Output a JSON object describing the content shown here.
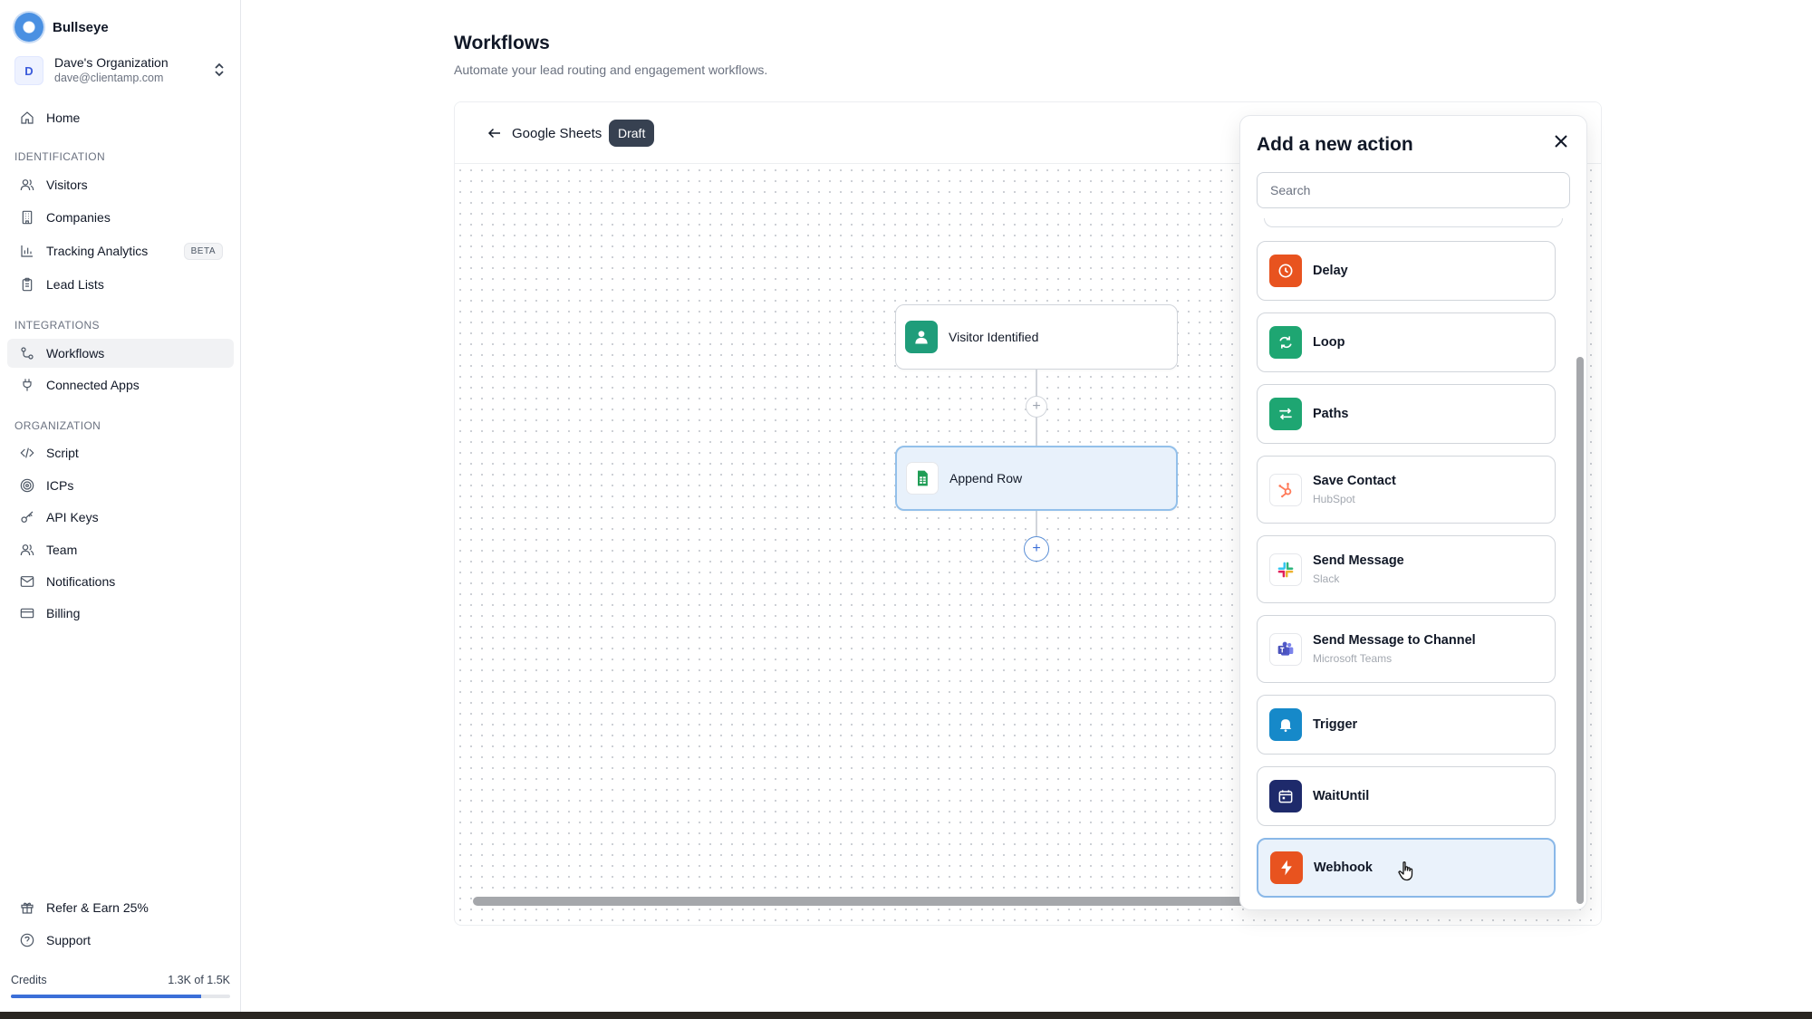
{
  "app": {
    "brand_name": "Bullseye",
    "org_name": "Dave's Organization",
    "org_email": "dave@clientamp.com",
    "org_initial": "D"
  },
  "sidebar": {
    "home": "Home",
    "section_identification": "IDENTIFICATION",
    "visitors": "Visitors",
    "companies": "Companies",
    "tracking_analytics": "Tracking Analytics",
    "beta_badge": "BETA",
    "lead_lists": "Lead Lists",
    "section_integrations": "INTEGRATIONS",
    "workflows": "Workflows",
    "connected_apps": "Connected Apps",
    "section_organization": "ORGANIZATION",
    "script": "Script",
    "icps": "ICPs",
    "api_keys": "API Keys",
    "team": "Team",
    "notifications": "Notifications",
    "billing": "Billing",
    "refer": "Refer & Earn 25%",
    "support": "Support",
    "credits_label": "Credits",
    "credits_value": "1.3K of 1.5K",
    "credits_fraction": 0.867
  },
  "main": {
    "title": "Workflows",
    "subtitle": "Automate your lead routing and engagement workflows.",
    "workflow_name": "Google Sheets",
    "status_badge": "Draft",
    "nodes": {
      "trigger_label": "Visitor Identified",
      "action_label": "Append Row"
    }
  },
  "panel": {
    "title": "Add a new action",
    "search_placeholder": "Search",
    "actions": [
      {
        "label": "Delay",
        "sub": "",
        "icon": "clock-icon",
        "color": "#e8531f"
      },
      {
        "label": "Loop",
        "sub": "",
        "icon": "loop-icon",
        "color": "#1ea672"
      },
      {
        "label": "Paths",
        "sub": "",
        "icon": "paths-icon",
        "color": "#1ea672"
      },
      {
        "label": "Save Contact",
        "sub": "HubSpot",
        "icon": "hubspot-icon",
        "color": "#ff7a59"
      },
      {
        "label": "Send Message",
        "sub": "Slack",
        "icon": "slack-icon",
        "color": "#4a154b"
      },
      {
        "label": "Send Message to Channel",
        "sub": "Microsoft Teams",
        "icon": "teams-icon",
        "color": "#5059c9"
      },
      {
        "label": "Trigger",
        "sub": "",
        "icon": "bell-icon",
        "color": "#1689c9"
      },
      {
        "label": "WaitUntil",
        "sub": "",
        "icon": "calendar-icon",
        "color": "#1e2a6b"
      },
      {
        "label": "Webhook",
        "sub": "",
        "icon": "bolt-icon",
        "color": "#e8531f"
      }
    ]
  },
  "colors": {
    "accent": "#3b6fd8",
    "selected_node_bg": "#e8f1fb",
    "sheets_green": "#1f9d55",
    "visitor_teal": "#1f9d7a"
  }
}
